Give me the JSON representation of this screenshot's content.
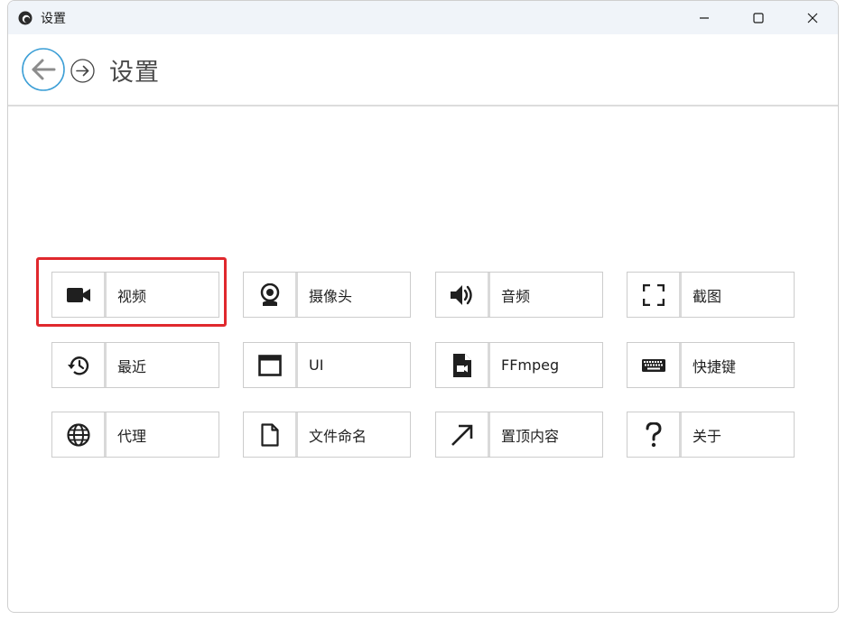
{
  "window": {
    "title": "设置",
    "controls": {
      "minimize": "minimize-icon",
      "maximize": "maximize-icon",
      "close": "close-icon"
    }
  },
  "nav": {
    "back_icon": "arrow-left-icon",
    "forward_icon": "arrow-right-icon",
    "title": "设置"
  },
  "tiles": [
    {
      "label": "视频",
      "icon": "video-camera-icon"
    },
    {
      "label": "摄像头",
      "icon": "webcam-icon"
    },
    {
      "label": "音频",
      "icon": "speaker-icon"
    },
    {
      "label": "截图",
      "icon": "screenshot-icon"
    },
    {
      "label": "最近",
      "icon": "history-icon"
    },
    {
      "label": "UI",
      "icon": "window-icon"
    },
    {
      "label": "FFmpeg",
      "icon": "video-file-icon"
    },
    {
      "label": "快捷键",
      "icon": "keyboard-icon"
    },
    {
      "label": "代理",
      "icon": "globe-icon"
    },
    {
      "label": "文件命名",
      "icon": "file-icon"
    },
    {
      "label": "置顶内容",
      "icon": "arrow-up-right-icon"
    },
    {
      "label": "关于",
      "icon": "question-icon"
    }
  ],
  "selected_tile": "视频",
  "colors": {
    "highlight": "#e0282d",
    "accent": "#3d9fd6",
    "titlebar": "#f0f4f9"
  }
}
